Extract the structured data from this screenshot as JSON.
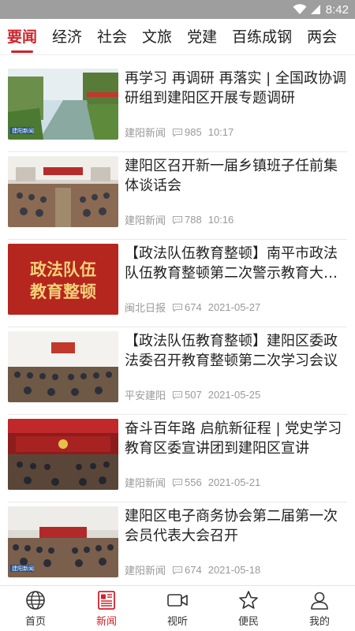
{
  "status_bar": {
    "time": "8:42"
  },
  "tabs": [
    {
      "label": "要闻",
      "active": true
    },
    {
      "label": "经济"
    },
    {
      "label": "社会"
    },
    {
      "label": "文旅"
    },
    {
      "label": "党建"
    },
    {
      "label": "百练成钢"
    },
    {
      "label": "两会"
    }
  ],
  "news": [
    {
      "title": "再学习 再调研 再落实 | 全国政协调研组到建阳区开展专题调研",
      "source": "建阳新闻",
      "comments": "985",
      "time": "10:17",
      "thumb": "river",
      "thumb_text": "建阳新闻"
    },
    {
      "title": "建阳区召开新一届乡镇班子任前集体谈话会",
      "source": "建阳新闻",
      "comments": "788",
      "time": "10:16",
      "thumb": "meeting-hall",
      "thumb_text": ""
    },
    {
      "title": "【政法队伍教育整顿】南平市政法队伍教育整顿第二次警示教育大会召开",
      "source": "闽北日报",
      "comments": "674",
      "time": "2021-05-27",
      "thumb": "red-banner",
      "thumb_text": "政法队伍\n教育整顿"
    },
    {
      "title": "【政法队伍教育整顿】建阳区委政法委召开教育整顿第二次学习会议",
      "source": "平安建阳",
      "comments": "507",
      "time": "2021-05-25",
      "thumb": "conference-room",
      "thumb_text": ""
    },
    {
      "title": "奋斗百年路 启航新征程 | 党史学习教育区委宣讲团到建阳区宣讲",
      "source": "建阳新闻",
      "comments": "556",
      "time": "2021-05-21",
      "thumb": "lecture",
      "thumb_text": ""
    },
    {
      "title": "建阳区电子商务协会第二届第一次会员代表大会召开",
      "source": "建阳新闻",
      "comments": "674",
      "time": "2021-05-18",
      "thumb": "assembly",
      "thumb_text": "建阳新闻"
    }
  ],
  "bottom_nav": [
    {
      "label": "首页",
      "icon": "globe-icon"
    },
    {
      "label": "新闻",
      "icon": "newspaper-icon",
      "active": true
    },
    {
      "label": "视听",
      "icon": "video-icon"
    },
    {
      "label": "便民",
      "icon": "star-icon"
    },
    {
      "label": "我的",
      "icon": "user-icon"
    }
  ],
  "colors": {
    "accent": "#d0232a",
    "status_bar": "#9e9e9e",
    "meta": "#999999"
  }
}
